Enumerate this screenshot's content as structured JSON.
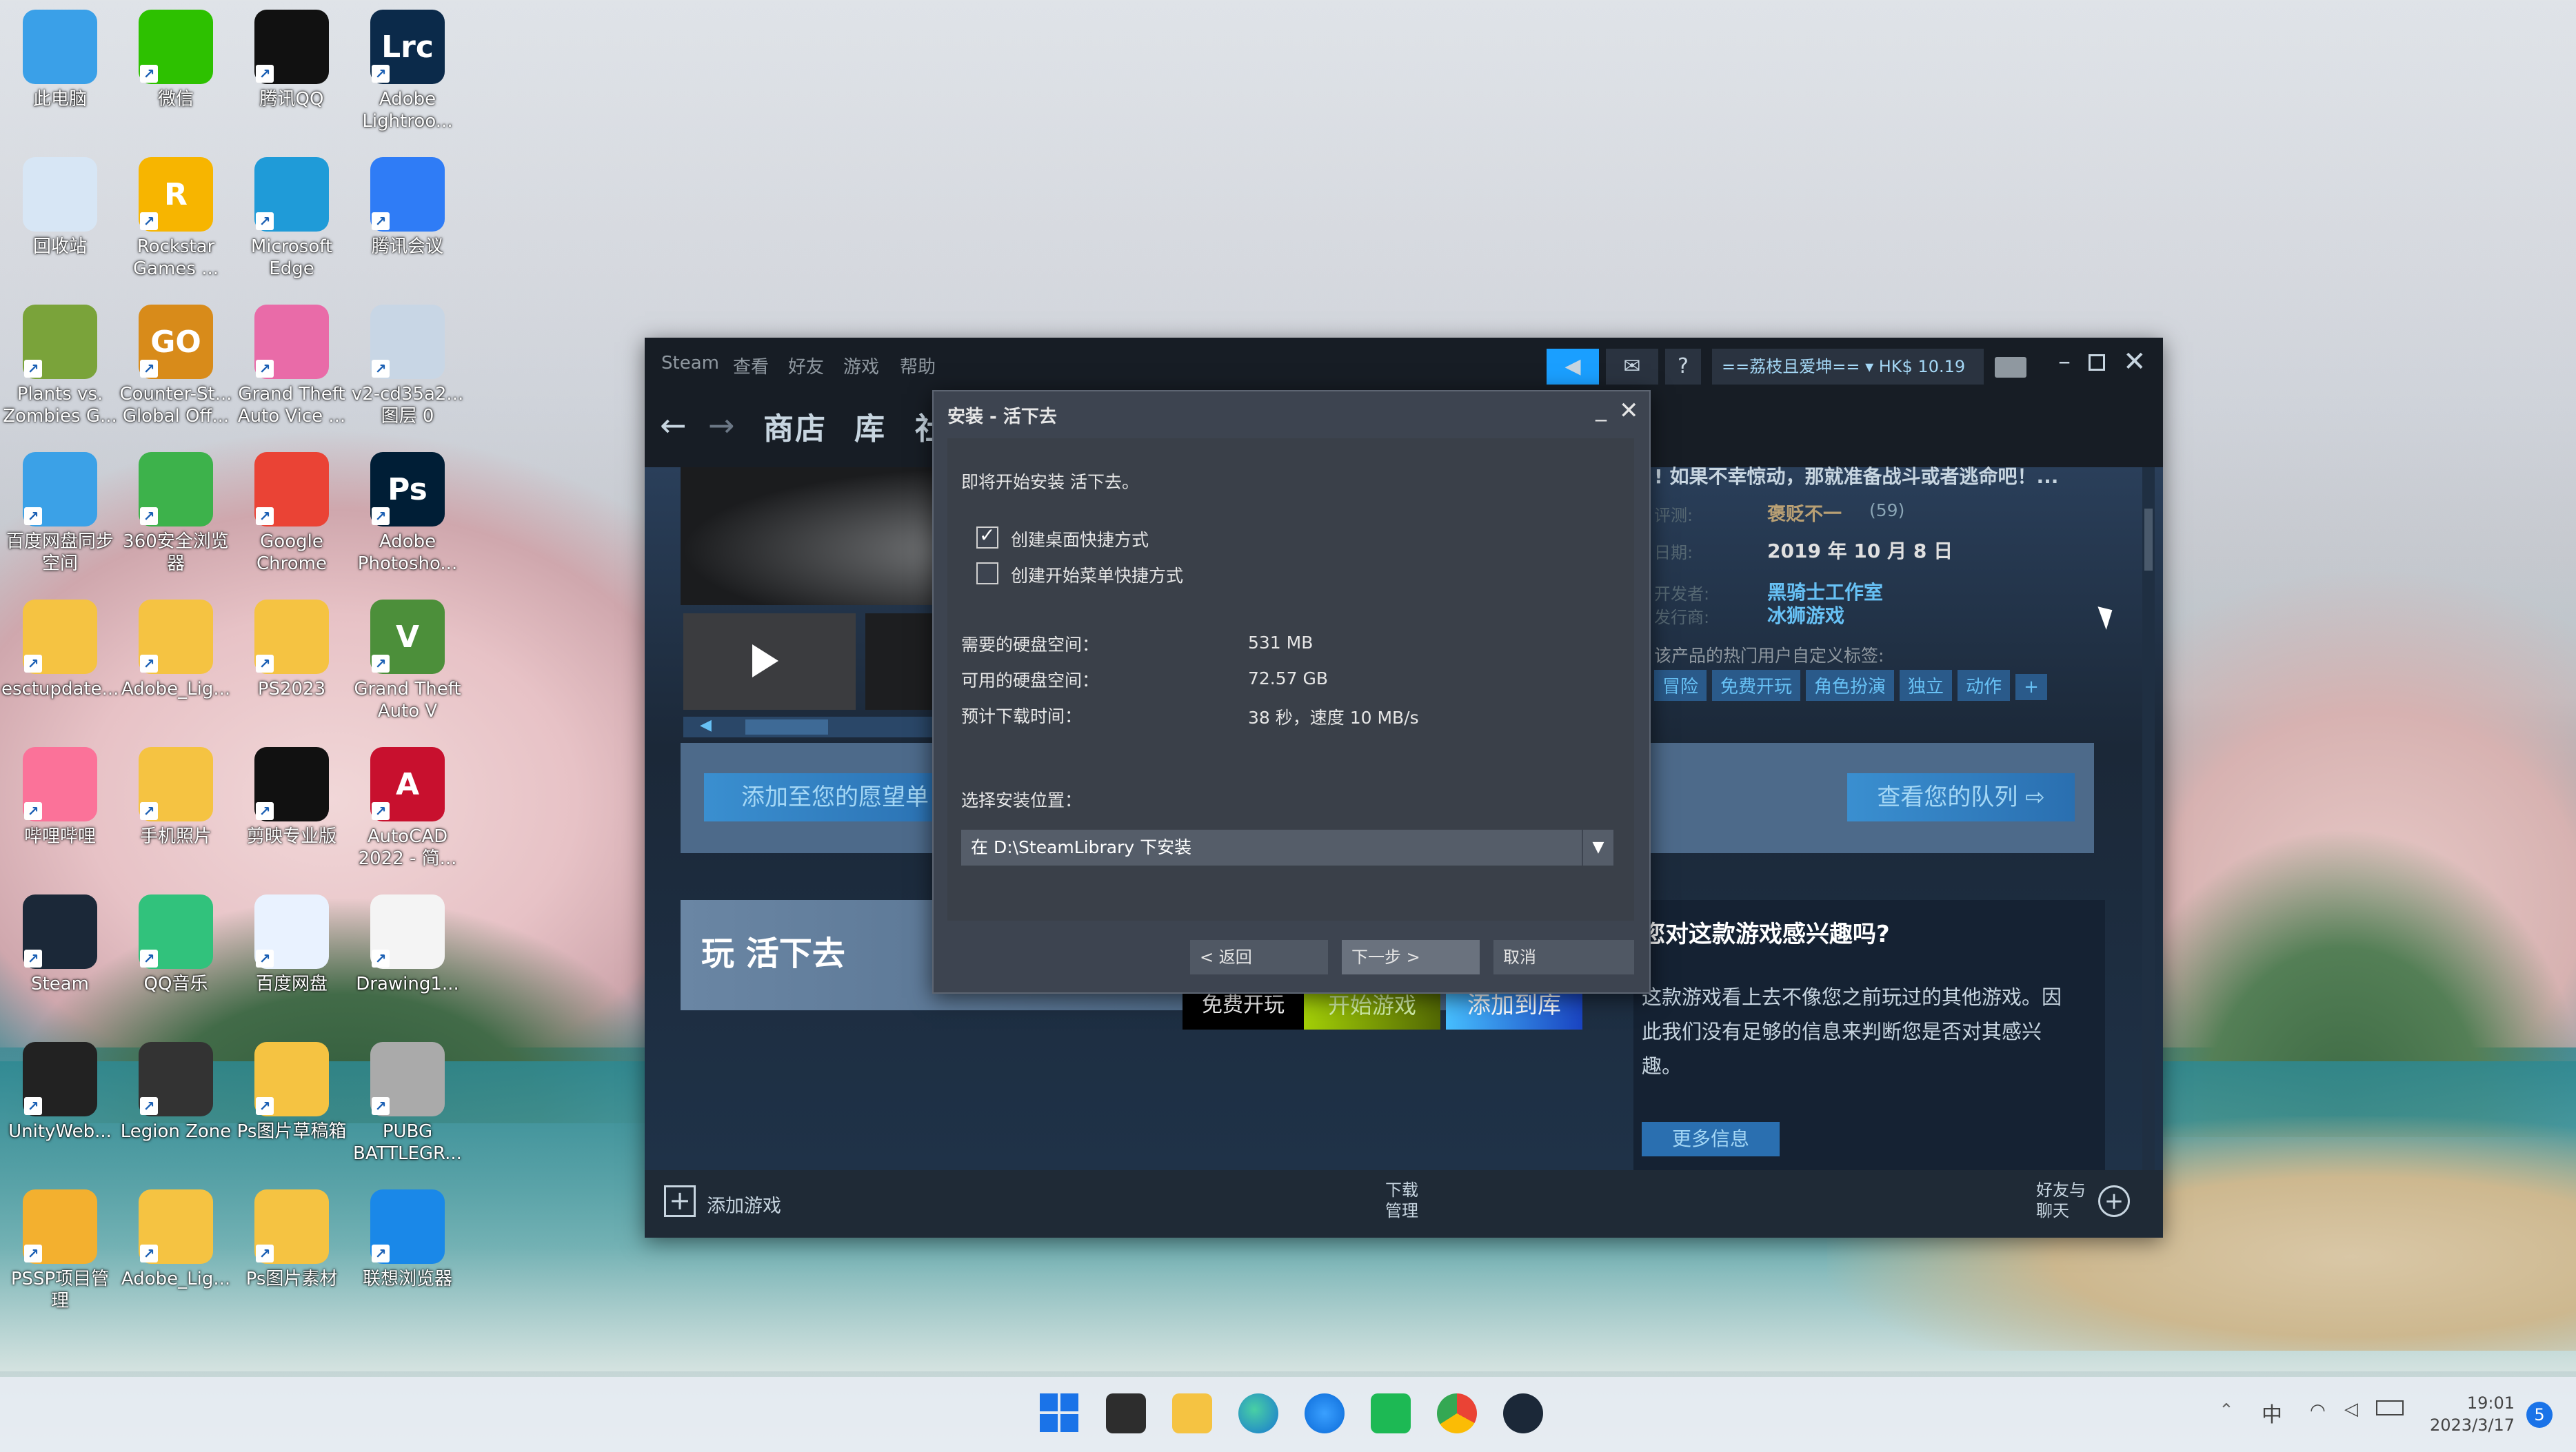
{
  "desktop": {
    "icons": [
      {
        "label": "此电脑",
        "icon": "this-pc-icon"
      },
      {
        "label": "微信",
        "icon": "wechat-icon"
      },
      {
        "label": "腾讯QQ",
        "icon": "qq-icon"
      },
      {
        "label": "Adobe\nLightroo...",
        "icon": "lightroom-icon"
      },
      {
        "label": "回收站",
        "icon": "recycle-bin-icon"
      },
      {
        "label": "Rockstar\nGames ...",
        "icon": "rockstar-icon"
      },
      {
        "label": "Microsoft\nEdge",
        "icon": "edge-icon"
      },
      {
        "label": "腾讯会议",
        "icon": "tencent-meeting-icon"
      },
      {
        "label": "Plants vs.\nZombies G...",
        "icon": "pvz-icon"
      },
      {
        "label": "Counter-St...\nGlobal Off...",
        "icon": "csgo-icon"
      },
      {
        "label": "Grand Theft\nAuto Vice ...",
        "icon": "gta-vc-icon"
      },
      {
        "label": "v2-cd35a2...\n图层 0",
        "icon": "image-file-icon"
      },
      {
        "label": "百度网盘同步\n空间",
        "icon": "baidu-sync-icon"
      },
      {
        "label": "360安全浏览\n器",
        "icon": "360-browser-icon"
      },
      {
        "label": "Google\nChrome",
        "icon": "chrome-icon"
      },
      {
        "label": "Adobe\nPhotosho...",
        "icon": "photoshop-icon"
      },
      {
        "label": "esctupdate...",
        "icon": "folder-icon"
      },
      {
        "label": "Adobe_Lig...",
        "icon": "folder-icon"
      },
      {
        "label": "PS2023",
        "icon": "folder-icon"
      },
      {
        "label": "Grand Theft\nAuto V",
        "icon": "gta-v-icon"
      },
      {
        "label": "哔哩哔哩",
        "icon": "bilibili-icon"
      },
      {
        "label": "手机照片",
        "icon": "folder-icon"
      },
      {
        "label": "剪映专业版",
        "icon": "capcut-icon"
      },
      {
        "label": "AutoCAD\n2022 - 简...",
        "icon": "autocad-icon"
      },
      {
        "label": "Steam",
        "icon": "steam-icon"
      },
      {
        "label": "QQ音乐",
        "icon": "qq-music-icon"
      },
      {
        "label": "百度网盘",
        "icon": "baidu-netdisk-icon"
      },
      {
        "label": "Drawing1...",
        "icon": "file-icon"
      },
      {
        "label": "UnityWeb...",
        "icon": "unity-icon"
      },
      {
        "label": "Legion Zone",
        "icon": "legion-icon"
      },
      {
        "label": "Ps图片草稿箱",
        "icon": "folder-icon"
      },
      {
        "label": "PUBG\nBATTLEGR...",
        "icon": "pubg-icon"
      },
      {
        "label": "PSSP项目管\n理",
        "icon": "pssp-icon"
      },
      {
        "label": "Adobe_Lig...",
        "icon": "folder-icon"
      },
      {
        "label": "Ps图片素材",
        "icon": "folder-icon"
      },
      {
        "label": "联想浏览器",
        "icon": "lenovo-browser-icon"
      }
    ]
  },
  "steam": {
    "menu": [
      "Steam",
      "查看",
      "好友",
      "游戏",
      "帮助"
    ],
    "account": "==荔枝且爱坤== ▾ HK$ 10.19",
    "help_label": "?",
    "nav": {
      "store": "商店",
      "library": "库",
      "community": "社"
    },
    "game": {
      "review_snippet": "! 如果不幸惊动，那就准备战斗或者逃命吧！...",
      "review_label": "评测:",
      "review_value": "褒贬不一",
      "review_count": "(59)",
      "date_label": "日期:",
      "release_date": "2019 年 10 月 8 日",
      "dev_label": "开发者:",
      "developer": "黑骑士工作室",
      "pub_label": "发行商:",
      "publisher": "冰狮游戏",
      "tags_label": "该产品的热门用户自定义标签:",
      "tags": [
        "冒险",
        "免费开玩",
        "角色扮演",
        "独立",
        "动作",
        "+"
      ],
      "wishlist_btn": "添加至您的愿望单",
      "queue_btn": "查看您的队列",
      "title": "玩 活下去",
      "free_label": "免费开玩",
      "play_btn": "开始游戏",
      "add_library_btn": "添加到库",
      "interest_title": "您对这款游戏感兴趣吗?",
      "interest_text": "这款游戏看上去不像您之前玩过的其他游戏。因此我们没有足够的信息来判断您是否对其感兴趣。",
      "more_info": "更多信息"
    },
    "bottom": {
      "add_game": "添加游戏",
      "downloads": "下载",
      "manage": "管理",
      "friends": "好友与",
      "chat": "聊天"
    }
  },
  "dialog": {
    "title": "安装 - 活下去",
    "intro": "即将开始安装 活下去。",
    "desktop_shortcut": {
      "label": "创建桌面快捷方式",
      "checked": true
    },
    "start_menu_shortcut": {
      "label": "创建开始菜单快捷方式",
      "checked": false
    },
    "disk_required_label": "需要的硬盘空间：",
    "disk_required": "531 MB",
    "disk_available_label": "可用的硬盘空间：",
    "disk_available": "72.57 GB",
    "download_time_label": "预计下载时间：",
    "download_time": "38 秒，速度 10 MB/s",
    "location_label": "选择安装位置：",
    "location_value": "在 D:\\SteamLibrary 下安装",
    "back_btn": "< 返回",
    "next_btn": "下一步 >",
    "cancel_btn": "取消"
  },
  "taskbar": {
    "ime": "中",
    "time": "19:01",
    "date": "2023/3/17",
    "notification_count": "5"
  }
}
